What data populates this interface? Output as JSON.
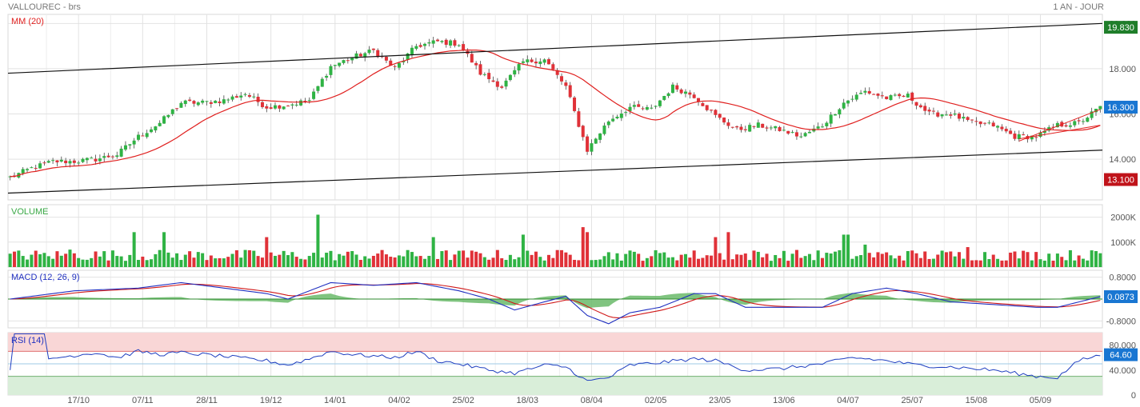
{
  "header": {
    "title": "VALLOUREC - brs",
    "period": "1 AN - JOUR"
  },
  "colors": {
    "up": "#2fb344",
    "down": "#e03138",
    "ma": "#e0201f",
    "channel": "#111111",
    "grid": "#e2e2e2",
    "volume_label": "#39a845",
    "macd_line": "#1f2fc0",
    "signal_line": "#d01818",
    "histogram": "#6aba6a",
    "rsi_line": "#1f3fc0",
    "overbought": "#f9d6d6",
    "oversold": "#d9eed9",
    "last_price_badge": "#1976d2",
    "high_badge": "#1f7e2a",
    "low_badge": "#c0131a"
  },
  "chart_data": [
    {
      "type": "candlestick",
      "title": "MM (20)",
      "ylim": [
        12.2,
        20.4
      ],
      "ytick_labels": [
        "20.000",
        "18.000",
        "16.000",
        "14.000"
      ],
      "ytick_values": [
        20,
        18,
        16,
        14
      ],
      "xtick_labels": [
        "17/10",
        "07/11",
        "28/11",
        "19/12",
        "14/01",
        "04/02",
        "25/02",
        "18/03",
        "08/04",
        "02/05",
        "23/05",
        "13/06",
        "04/07",
        "25/07",
        "15/08",
        "05/09"
      ],
      "xtick_index": [
        16,
        31,
        46,
        61,
        76,
        91,
        106,
        121,
        136,
        151,
        166,
        181,
        196,
        211,
        226,
        241
      ],
      "n_bars": 256,
      "close_anchors": [
        [
          0,
          13.2
        ],
        [
          5,
          13.6
        ],
        [
          10,
          13.9
        ],
        [
          15,
          13.9
        ],
        [
          20,
          14.0
        ],
        [
          25,
          14.2
        ],
        [
          30,
          15.0
        ],
        [
          35,
          15.6
        ],
        [
          40,
          16.5
        ],
        [
          45,
          16.5
        ],
        [
          50,
          16.6
        ],
        [
          55,
          16.9
        ],
        [
          60,
          16.3
        ],
        [
          65,
          16.4
        ],
        [
          70,
          16.6
        ],
        [
          75,
          18.1
        ],
        [
          80,
          18.5
        ],
        [
          85,
          18.8
        ],
        [
          90,
          18.0
        ],
        [
          95,
          19.0
        ],
        [
          100,
          19.2
        ],
        [
          105,
          19.1
        ],
        [
          110,
          17.8
        ],
        [
          115,
          17.2
        ],
        [
          120,
          18.3
        ],
        [
          125,
          18.4
        ],
        [
          130,
          17.2
        ],
        [
          135,
          14.4
        ],
        [
          140,
          15.7
        ],
        [
          145,
          16.3
        ],
        [
          150,
          16.2
        ],
        [
          155,
          17.2
        ],
        [
          160,
          16.8
        ],
        [
          165,
          15.9
        ],
        [
          170,
          15.3
        ],
        [
          175,
          15.5
        ],
        [
          180,
          15.3
        ],
        [
          185,
          15.0
        ],
        [
          190,
          15.5
        ],
        [
          195,
          16.5
        ],
        [
          200,
          17.0
        ],
        [
          205,
          16.7
        ],
        [
          210,
          16.8
        ],
        [
          215,
          16.0
        ],
        [
          220,
          16.0
        ],
        [
          225,
          15.6
        ],
        [
          230,
          15.5
        ],
        [
          235,
          15.0
        ],
        [
          240,
          15.0
        ],
        [
          245,
          15.5
        ],
        [
          250,
          15.6
        ],
        [
          255,
          16.3
        ]
      ],
      "indicator": "MM (20)",
      "channel": {
        "upper": [
          [
            0,
            17.8
          ],
          [
            255,
            20.0
          ]
        ],
        "lower": [
          [
            0,
            12.5
          ],
          [
            255,
            14.4
          ]
        ],
        "minor_upper": [
          [
            236,
            14.8
          ],
          [
            255,
            16.2
          ]
        ],
        "minor_lower": [
          [
            236,
            14.9
          ],
          [
            255,
            15.5
          ]
        ]
      },
      "badges": {
        "high": "19.830",
        "high_value": 19.83,
        "last": "16.300",
        "last_value": 16.3,
        "low": "13.100",
        "low_value": 13.1
      }
    },
    {
      "type": "bar",
      "title": "VOLUME",
      "ytick_labels": [
        "2000K",
        "1000K"
      ],
      "ytick_values": [
        2000,
        1000
      ],
      "ylim": [
        0,
        2500
      ],
      "peaks": [
        [
          14,
          700
        ],
        [
          29,
          1400
        ],
        [
          36,
          1400
        ],
        [
          72,
          2100
        ],
        [
          60,
          1200
        ],
        [
          99,
          1200
        ],
        [
          120,
          1300
        ],
        [
          134,
          1600
        ],
        [
          135,
          1400
        ],
        [
          165,
          1200
        ],
        [
          168,
          1400
        ],
        [
          195,
          1300
        ],
        [
          196,
          1300
        ],
        [
          200,
          900
        ],
        [
          224,
          800
        ]
      ]
    },
    {
      "type": "line",
      "title": "MACD (12, 26, 9)",
      "ylim": [
        -1.05,
        1.05
      ],
      "ytick_labels": [
        "0.8000",
        "-0.8000"
      ],
      "ytick_values": [
        0.8,
        -0.8
      ],
      "macd_anchors": [
        [
          0,
          0.0
        ],
        [
          15,
          0.3
        ],
        [
          30,
          0.4
        ],
        [
          40,
          0.6
        ],
        [
          50,
          0.4
        ],
        [
          60,
          0.2
        ],
        [
          65,
          0.0
        ],
        [
          75,
          0.6
        ],
        [
          85,
          0.5
        ],
        [
          95,
          0.6
        ],
        [
          105,
          0.3
        ],
        [
          112,
          0.0
        ],
        [
          118,
          -0.4
        ],
        [
          125,
          -0.1
        ],
        [
          130,
          0.1
        ],
        [
          135,
          -0.6
        ],
        [
          140,
          -0.9
        ],
        [
          145,
          -0.5
        ],
        [
          152,
          -0.3
        ],
        [
          160,
          0.2
        ],
        [
          165,
          0.2
        ],
        [
          172,
          -0.3
        ],
        [
          180,
          -0.3
        ],
        [
          190,
          -0.3
        ],
        [
          197,
          0.2
        ],
        [
          205,
          0.4
        ],
        [
          212,
          0.2
        ],
        [
          220,
          -0.1
        ],
        [
          230,
          -0.2
        ],
        [
          240,
          -0.3
        ],
        [
          245,
          -0.3
        ],
        [
          255,
          0.09
        ]
      ],
      "last": "0.0873",
      "last_value": 0.0873
    },
    {
      "type": "line",
      "title": "RSI (14)",
      "ylim": [
        0,
        100
      ],
      "ytick_labels": [
        "80.000",
        "40.000",
        "0"
      ],
      "ytick_values": [
        80,
        40,
        0
      ],
      "zones": {
        "overbought": 70,
        "oversold": 30
      },
      "rsi_anchors": [
        [
          0,
          40
        ],
        [
          1,
          98
        ],
        [
          8,
          98
        ],
        [
          9,
          58
        ],
        [
          20,
          68
        ],
        [
          25,
          60
        ],
        [
          30,
          70
        ],
        [
          35,
          65
        ],
        [
          40,
          68
        ],
        [
          50,
          62
        ],
        [
          60,
          55
        ],
        [
          65,
          48
        ],
        [
          70,
          58
        ],
        [
          75,
          70
        ],
        [
          80,
          65
        ],
        [
          90,
          60
        ],
        [
          95,
          70
        ],
        [
          100,
          55
        ],
        [
          105,
          50
        ],
        [
          112,
          40
        ],
        [
          118,
          35
        ],
        [
          125,
          48
        ],
        [
          130,
          45
        ],
        [
          135,
          22
        ],
        [
          140,
          28
        ],
        [
          145,
          48
        ],
        [
          152,
          52
        ],
        [
          160,
          58
        ],
        [
          165,
          55
        ],
        [
          172,
          40
        ],
        [
          180,
          42
        ],
        [
          190,
          50
        ],
        [
          197,
          60
        ],
        [
          205,
          55
        ],
        [
          212,
          48
        ],
        [
          220,
          45
        ],
        [
          230,
          40
        ],
        [
          240,
          30
        ],
        [
          245,
          28
        ],
        [
          250,
          55
        ],
        [
          255,
          64.6
        ]
      ],
      "last": "64.60",
      "last_value": 64.6
    }
  ]
}
